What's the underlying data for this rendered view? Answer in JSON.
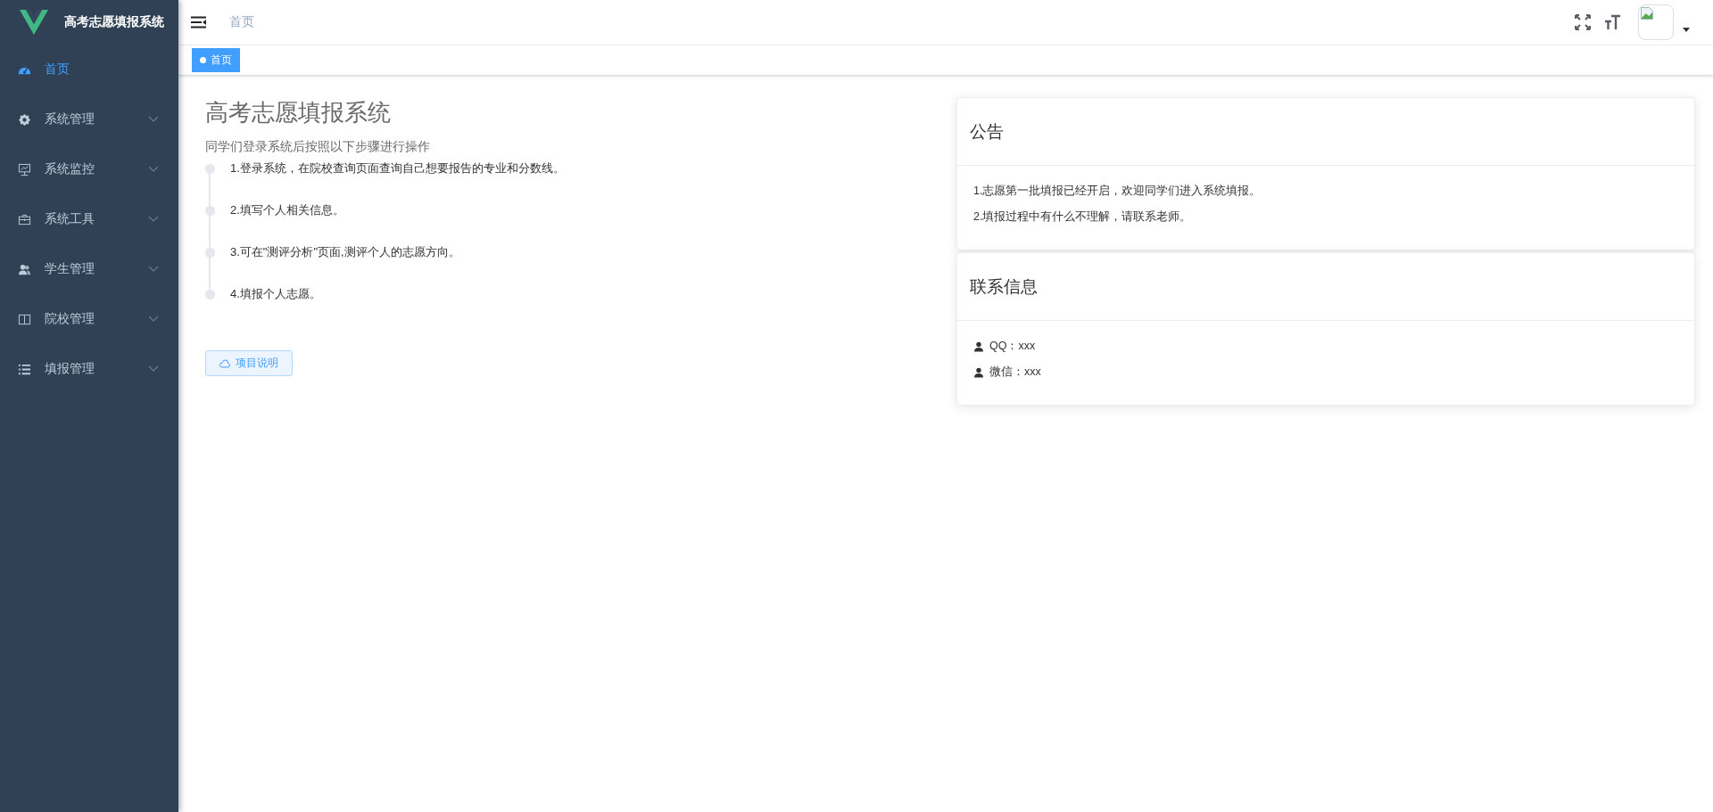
{
  "sidebar": {
    "title": "高考志愿填报系统",
    "items": [
      {
        "label": "首页",
        "selected": true,
        "expandable": false
      },
      {
        "label": "系统管理",
        "selected": false,
        "expandable": true
      },
      {
        "label": "系统监控",
        "selected": false,
        "expandable": true
      },
      {
        "label": "系统工具",
        "selected": false,
        "expandable": true
      },
      {
        "label": "学生管理",
        "selected": false,
        "expandable": true
      },
      {
        "label": "院校管理",
        "selected": false,
        "expandable": true
      },
      {
        "label": "填报管理",
        "selected": false,
        "expandable": true
      }
    ]
  },
  "breadcrumb": [
    "首页"
  ],
  "tags": [
    {
      "label": "首页",
      "selected": true
    }
  ],
  "intro": {
    "title": "高考志愿填报系统",
    "subtitle": "同学们登录系统后按照以下步骤进行操作",
    "steps": [
      "1.登录系统，在院校查询页面查询自己想要报告的专业和分数线。",
      "2.填写个人相关信息。",
      "3.可在\"测评分析\"页面,测评个人的志愿方向。",
      "4.填报个人志愿。"
    ],
    "button": "项目说明"
  },
  "notice": {
    "title": "公告",
    "lines": [
      "1.志愿第一批填报已经开启，欢迎同学们进入系统填报。",
      "2.填报过程中有什么不理解，请联系老师。"
    ]
  },
  "contact": {
    "title": "联系信息",
    "lines": [
      "QQ：xxx",
      "微信：xxx"
    ]
  }
}
